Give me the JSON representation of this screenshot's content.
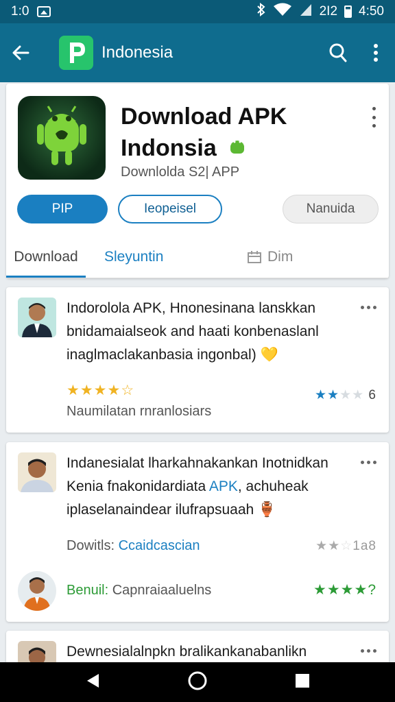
{
  "status": {
    "time_left": "1:0",
    "net": "2I2",
    "time_right": "4:50"
  },
  "appbar": {
    "title": "Indonesia",
    "colors": {
      "primary": "#0f6c8e",
      "brand": "#27c46c"
    }
  },
  "app": {
    "name_line1": "Download APK",
    "name_line2": "Indonsia",
    "subtitle": "Downlolda S2| APP",
    "buttons": {
      "primary": "PIP",
      "outline": "Ieopeisel",
      "gray": "Nanuida"
    },
    "tabs": [
      "Download",
      "Sleyuntin",
      "Dim"
    ]
  },
  "reviews": [
    {
      "lines": [
        "Indorolola APK, Hnonesinana lanskkan",
        "bnidamaialseok and haati konbenaslanl",
        "inaglmaclakanbasia ingonbal)"
      ],
      "emoji": "💛",
      "rating": 4,
      "footer": "Naumilatan rnranlosiars",
      "right_rating_count": 2,
      "right_value": "6"
    },
    {
      "lines": [
        "Indanesialat lharkahnakankan Inotnidkan",
        "Kenia fnakonidardiata",
        "iplaselanaindear ilufrapsuaah"
      ],
      "line2_accent": "APK",
      "line2_end": ", achuheak",
      "emoji": "🏺",
      "meta_label": "Dowitls:",
      "meta_value": "Ccaidcascian",
      "right_value": "1a8",
      "reply_label": "Benuil:",
      "reply_value": "Capnraiaaluelns",
      "reply_stars": "★★★★?"
    },
    {
      "lines": [
        "Dewnesialalnpkn bralikankanabanlikn"
      ]
    }
  ]
}
